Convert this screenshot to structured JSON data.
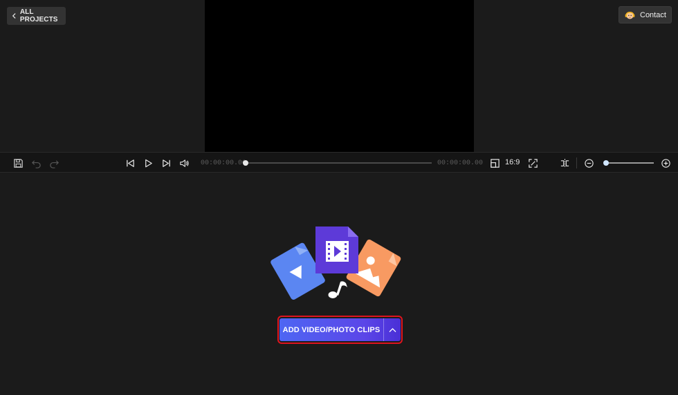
{
  "header": {
    "back_label": "ALL PROJECTS",
    "contact_label": "Contact"
  },
  "player": {
    "current_time": "00:00:00.00",
    "total_time": "00:00:00.00",
    "aspect_ratio": "16:9",
    "progress": 0,
    "zoom_level": 0
  },
  "toolbar": {
    "icons": [
      "save-icon",
      "undo-icon",
      "redo-icon",
      "skip-back-icon",
      "play-icon",
      "skip-forward-icon",
      "volume-icon",
      "aspect-ratio-icon",
      "fullscreen-icon",
      "split-icon",
      "zoom-out-icon",
      "zoom-in-icon"
    ]
  },
  "empty_state": {
    "add_button_label": "ADD VIDEO/PHOTO CLIPS",
    "illustration_icons": [
      "video-file-icon",
      "audio-file-icon",
      "image-file-icon",
      "music-note-icon"
    ]
  },
  "colors": {
    "background": "#1b1b1b",
    "preview": "#000000",
    "accent_start": "#4e66f3",
    "accent_end": "#4a2fd6",
    "highlight": "#e0141e"
  }
}
